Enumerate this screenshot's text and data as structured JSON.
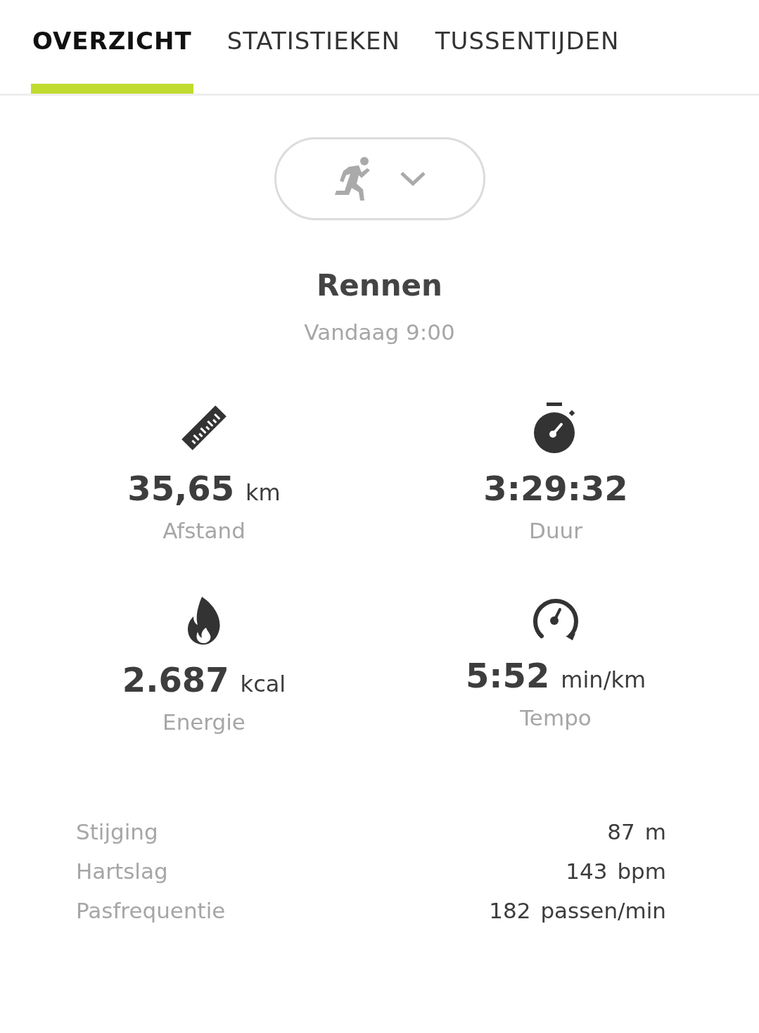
{
  "tabs": [
    {
      "label": "OVERZICHT",
      "selected": true
    },
    {
      "label": "STATISTIEKEN",
      "selected": false
    },
    {
      "label": "TUSSENTIJDEN",
      "selected": false
    }
  ],
  "activity_picker": {
    "kind": "running"
  },
  "activity": {
    "title": "Rennen",
    "time": "Vandaag 9:00"
  },
  "stats": [
    {
      "kind": "ruler",
      "value": "35,65",
      "unit": "km",
      "label": "Afstand"
    },
    {
      "kind": "stopwatch",
      "value": "3:29:32",
      "label": "Duur"
    },
    {
      "kind": "flame",
      "value": "2.687",
      "unit": "kcal",
      "label": "Energie"
    },
    {
      "kind": "gauge",
      "value": "5:52",
      "unit": "min/km",
      "label": "Tempo"
    }
  ],
  "details": [
    {
      "label": "Stijging",
      "value": "87",
      "unit": "m"
    },
    {
      "label": "Hartslag",
      "value": "143",
      "unit": "bpm"
    },
    {
      "label": "Pasfrequentie",
      "value": "182",
      "unit": "passen/min"
    }
  ]
}
